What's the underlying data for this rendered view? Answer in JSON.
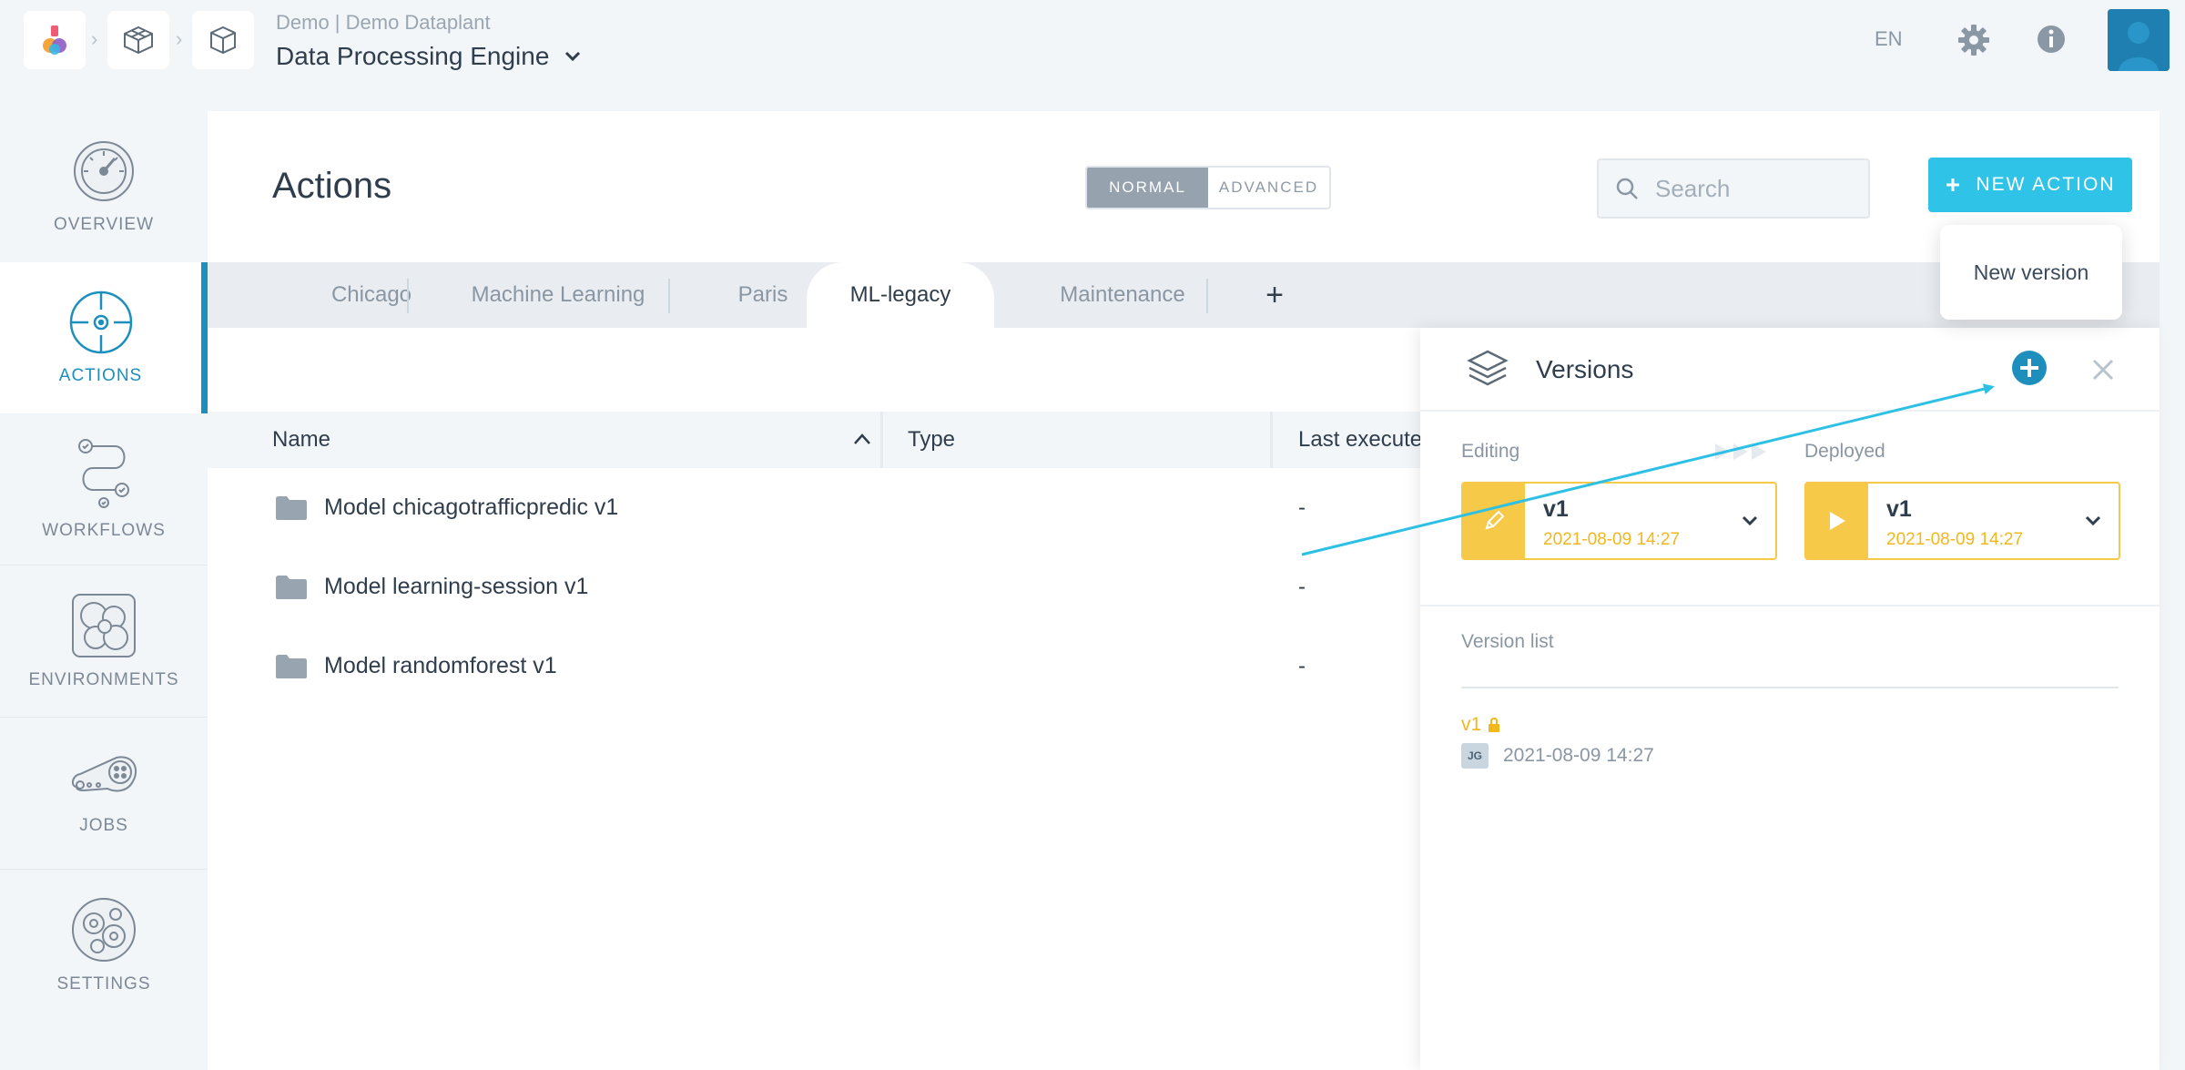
{
  "header": {
    "org": "Demo | Demo Dataplant",
    "project": "Data Processing Engine",
    "language": "EN"
  },
  "sidebar": {
    "items": [
      {
        "label": "OVERVIEW",
        "icon": "gauge-icon"
      },
      {
        "label": "ACTIONS",
        "icon": "actions-target-icon"
      },
      {
        "label": "WORKFLOWS",
        "icon": "workflow-icon"
      },
      {
        "label": "ENVIRONMENTS",
        "icon": "environments-icon"
      },
      {
        "label": "JOBS",
        "icon": "jobs-icon"
      },
      {
        "label": "SETTINGS",
        "icon": "gears-icon"
      }
    ]
  },
  "main": {
    "title": "Actions",
    "mode_toggle": {
      "normal": "NORMAL",
      "advanced": "ADVANCED",
      "selected": "NORMAL"
    },
    "search_placeholder": "Search",
    "new_action_label": "NEW ACTION",
    "tooltip": "New version",
    "tabs": [
      "Chicago",
      "Machine Learning",
      "Paris",
      "ML-legacy",
      "Maintenance"
    ],
    "active_tab": "ML-legacy",
    "add_tab_label": "+",
    "table": {
      "columns": [
        "Name",
        "Type",
        "Last execute"
      ],
      "rows": [
        {
          "name": "Model chicagotrafficpredic v1",
          "last_executed": "-"
        },
        {
          "name": "Model learning-session v1",
          "last_executed": "-"
        },
        {
          "name": "Model randomforest v1",
          "last_executed": "-"
        }
      ]
    }
  },
  "versions_panel": {
    "title": "Versions",
    "editing_label": "Editing",
    "deployed_label": "Deployed",
    "editing": {
      "version": "v1",
      "date": "2021-08-09 14:27"
    },
    "deployed": {
      "version": "v1",
      "date": "2021-08-09 14:27"
    },
    "list_label": "Version list",
    "list": [
      {
        "version": "v1",
        "initials": "JG",
        "date": "2021-08-09 14:27",
        "locked": true
      }
    ]
  },
  "colors": {
    "accent": "#1e8fbd",
    "button": "#2fc3e8",
    "version_yellow": "#f7c948",
    "annotation_arrow": "#2ec0e4"
  }
}
